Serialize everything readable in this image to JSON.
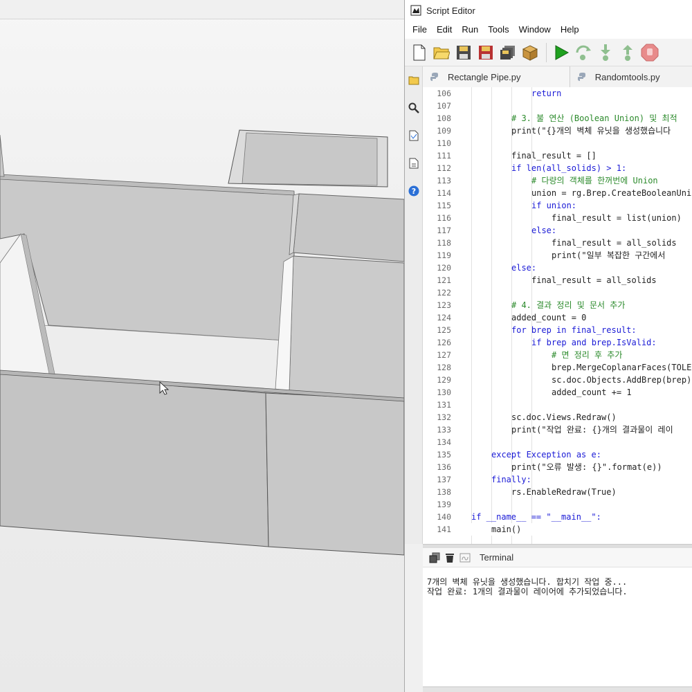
{
  "editor": {
    "title": "Script Editor",
    "menu": [
      "File",
      "Edit",
      "Run",
      "Tools",
      "Window",
      "Help"
    ],
    "toolbar_icons": [
      "new-file-icon",
      "open-folder-icon",
      "save-icon",
      "save-as-icon",
      "save-all-icon",
      "package-icon",
      "run-icon",
      "step-over-icon",
      "step-into-icon",
      "step-out-icon",
      "stop-icon"
    ],
    "side_icons": [
      "folder-icon",
      "search-icon",
      "document-icon",
      "file-icon",
      "help-icon"
    ],
    "tabs": [
      {
        "label": "Rectangle Pipe.py"
      },
      {
        "label": "Randomtools.py"
      }
    ],
    "code_lines": [
      {
        "num": "106",
        "indent": 3,
        "text": "return"
      },
      {
        "num": "107",
        "indent": 0,
        "text": ""
      },
      {
        "num": "108",
        "indent": 2,
        "text": "# 3. 불 연산 (Boolean Union) 및 최적"
      },
      {
        "num": "109",
        "indent": 2,
        "text": "print(\"{}개의 벽체 유닛을 생성했습니다"
      },
      {
        "num": "110",
        "indent": 0,
        "text": ""
      },
      {
        "num": "111",
        "indent": 2,
        "text": "final_result = []"
      },
      {
        "num": "112",
        "indent": 2,
        "text": "if len(all_solids) > 1:"
      },
      {
        "num": "113",
        "indent": 3,
        "text": "# 다량의 객체를 한꺼번에 Union"
      },
      {
        "num": "114",
        "indent": 3,
        "text": "union = rg.Brep.CreateBooleanUni"
      },
      {
        "num": "115",
        "indent": 3,
        "text": "if union:"
      },
      {
        "num": "116",
        "indent": 4,
        "text": "final_result = list(union)"
      },
      {
        "num": "117",
        "indent": 3,
        "text": "else:"
      },
      {
        "num": "118",
        "indent": 4,
        "text": "final_result = all_solids"
      },
      {
        "num": "119",
        "indent": 4,
        "text": "print(\"일부 복잡한 구간에서"
      },
      {
        "num": "120",
        "indent": 2,
        "text": "else:"
      },
      {
        "num": "121",
        "indent": 3,
        "text": "final_result = all_solids"
      },
      {
        "num": "122",
        "indent": 0,
        "text": ""
      },
      {
        "num": "123",
        "indent": 2,
        "text": "# 4. 결과 정리 및 문서 추가"
      },
      {
        "num": "124",
        "indent": 2,
        "text": "added_count = 0"
      },
      {
        "num": "125",
        "indent": 2,
        "text": "for brep in final_result:"
      },
      {
        "num": "126",
        "indent": 3,
        "text": "if brep and brep.IsValid:"
      },
      {
        "num": "127",
        "indent": 4,
        "text": "# 면 정리 후 추가"
      },
      {
        "num": "128",
        "indent": 4,
        "text": "brep.MergeCoplanarFaces(TOLE"
      },
      {
        "num": "129",
        "indent": 4,
        "text": "sc.doc.Objects.AddBrep(brep)"
      },
      {
        "num": "130",
        "indent": 4,
        "text": "added_count += 1"
      },
      {
        "num": "131",
        "indent": 0,
        "text": ""
      },
      {
        "num": "132",
        "indent": 2,
        "text": "sc.doc.Views.Redraw()"
      },
      {
        "num": "133",
        "indent": 2,
        "text": "print(\"작업 완료: {}개의 결과물이 레이"
      },
      {
        "num": "134",
        "indent": 0,
        "text": ""
      },
      {
        "num": "135",
        "indent": 1,
        "text": "except Exception as e:"
      },
      {
        "num": "136",
        "indent": 2,
        "text": "print(\"오류 발생: {}\".format(e))"
      },
      {
        "num": "137",
        "indent": 1,
        "text": "finally:"
      },
      {
        "num": "138",
        "indent": 2,
        "text": "rs.EnableRedraw(True)"
      },
      {
        "num": "139",
        "indent": 0,
        "text": ""
      },
      {
        "num": "140",
        "indent": 0,
        "text": "if __name__ == \"__main__\":"
      },
      {
        "num": "141",
        "indent": 1,
        "text": "main()"
      }
    ],
    "terminal": {
      "label": "Terminal",
      "output": [
        "7개의 벽체 유닛을 생성했습니다. 합치기 작업 중...",
        "작업 완료: 1개의 결과물이 레이어에 추가되었습니다."
      ]
    }
  }
}
